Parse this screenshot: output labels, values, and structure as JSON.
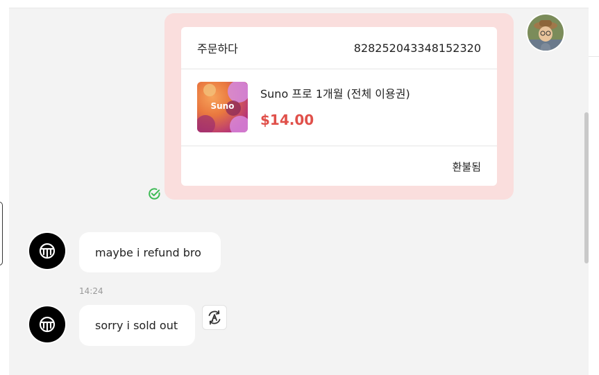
{
  "order_card": {
    "header_label": "주문하다",
    "order_number": "828252043348152320",
    "product": {
      "image_label": "Suno",
      "title": "Suno 프로 1개월 (전체 이용권)",
      "price": "$14.00"
    },
    "status": "환불됨"
  },
  "messages": [
    {
      "text": "maybe i refund bro"
    },
    {
      "timestamp": "14:24",
      "text": "sorry i sold out"
    }
  ],
  "colors": {
    "accent_price": "#e0504a",
    "card_background": "#fadedd",
    "read_check": "#3cba54"
  },
  "icons": {
    "read_status": "check-circle-icon",
    "translate": "translate-icon",
    "bot_logo": "bot-logo-icon"
  }
}
